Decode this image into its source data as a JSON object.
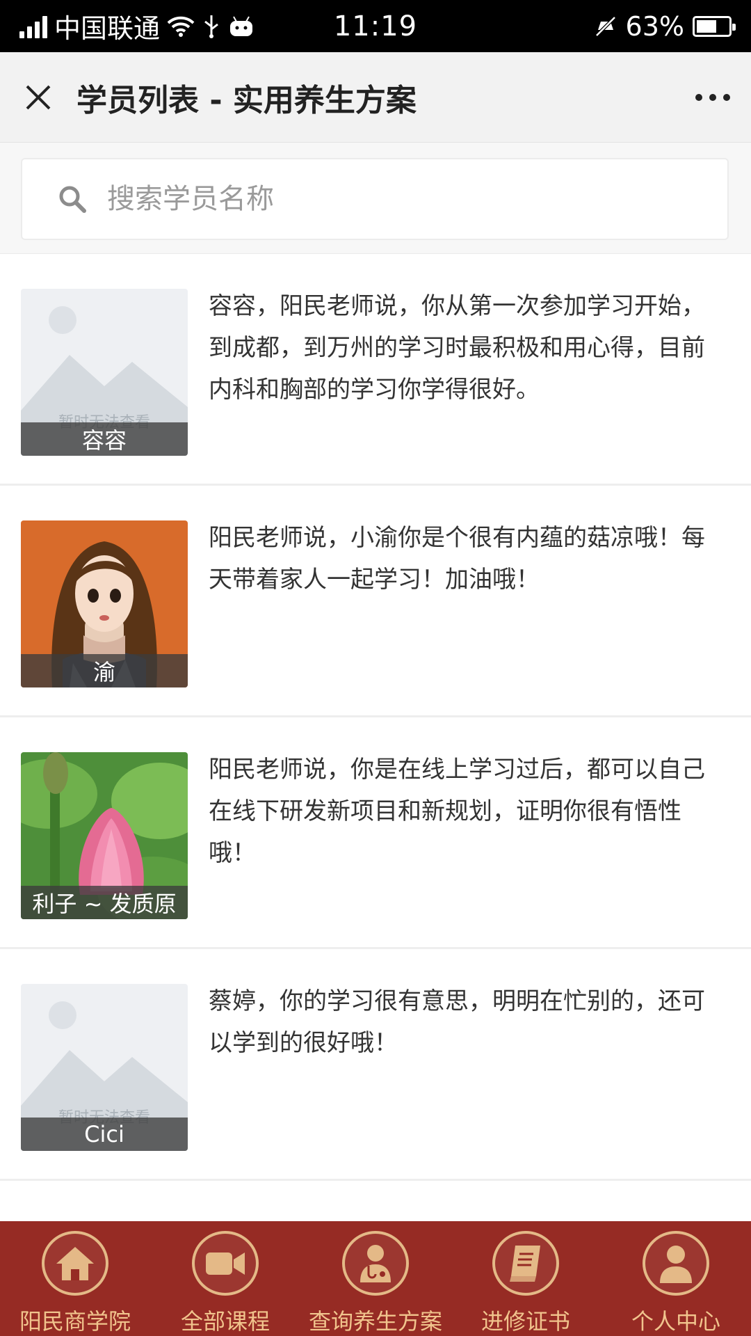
{
  "status_bar": {
    "carrier": "中国联通",
    "time": "11:19",
    "battery": "63%",
    "battery_level": 0.63
  },
  "header": {
    "title": "学员列表 - 实用养生方案"
  },
  "search": {
    "placeholder": "搜索学员名称"
  },
  "students": [
    {
      "name": "容容",
      "message": "容容，阳民老师说，你从第一次参加学习开始，到成都，到万州的学习时最积极和用心得，目前内科和胸部的学习你学得很好。",
      "avatar": "placeholder",
      "placeholder_text": "暂时无法查看"
    },
    {
      "name": "渝",
      "message": "阳民老师说，小渝你是个很有内蕴的菇凉哦！每天带着家人一起学习！加油哦！",
      "avatar": "girl-portrait"
    },
    {
      "name": "利子 ~ 发质原",
      "message": "阳民老师说，你是在线上学习过后，都可以自己在线下研发新项目和新规划，证明你很有悟性哦！",
      "avatar": "lotus-flower"
    },
    {
      "name": "Cici",
      "message": "蔡婷，你的学习很有意思，明明在忙别的，还可以学到的很好哦！",
      "avatar": "placeholder",
      "placeholder_text": "暂时无法查看"
    }
  ],
  "bottom_nav": [
    {
      "label": "阳民商学院",
      "icon": "home-icon"
    },
    {
      "label": "全部课程",
      "icon": "video-camera-icon"
    },
    {
      "label": "查询养生方案",
      "icon": "doctor-icon"
    },
    {
      "label": "进修证书",
      "icon": "book-icon"
    },
    {
      "label": "个人中心",
      "icon": "user-icon"
    }
  ],
  "colors": {
    "nav_bg": "#962b24",
    "nav_accent": "#e4b987",
    "nav_text": "#f1c48d"
  }
}
